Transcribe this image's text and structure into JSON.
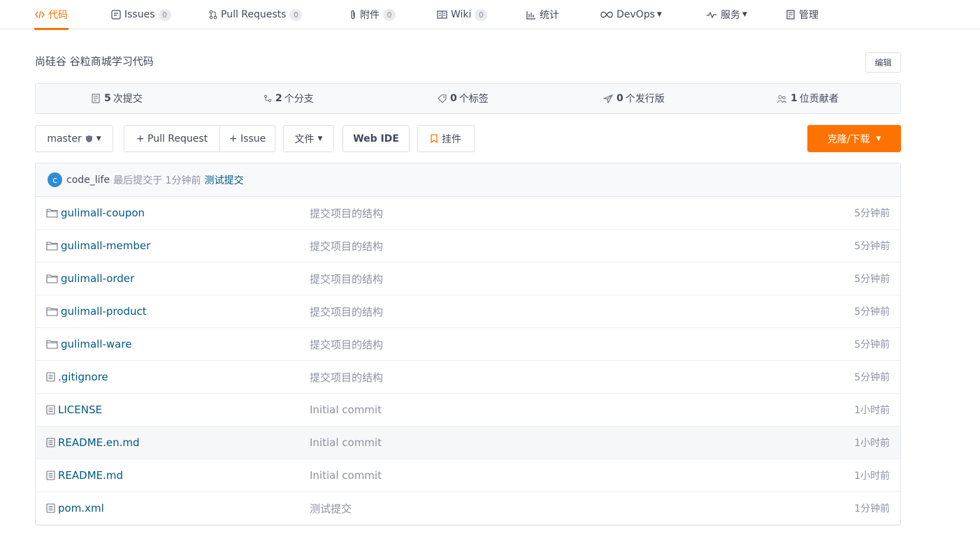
{
  "nav": {
    "tabs": [
      {
        "label": "代码",
        "icon": "code-icon",
        "active": true
      },
      {
        "label": "Issues",
        "badge": "0",
        "icon": "issue-icon"
      },
      {
        "label": "Pull Requests",
        "badge": "0",
        "icon": "pull-request-icon"
      },
      {
        "label": "附件",
        "badge": "0",
        "icon": "paperclip-icon"
      },
      {
        "label": "Wiki",
        "badge": "0",
        "icon": "book-icon"
      },
      {
        "label": "统计",
        "icon": "bar-chart-icon"
      },
      {
        "label": "DevOps",
        "icon": "infinity-icon",
        "dropdown": true
      },
      {
        "label": "服务",
        "icon": "pulse-icon",
        "dropdown": true
      },
      {
        "label": "管理",
        "icon": "manage-icon"
      }
    ]
  },
  "repo": {
    "description": "尚硅谷 谷粒商城学习代码",
    "edit_label": "编辑"
  },
  "stats": [
    {
      "count": "5",
      "label": "次提交",
      "icon": "commit-icon"
    },
    {
      "count": "2",
      "label": "个分支",
      "icon": "branch-icon"
    },
    {
      "count": "0",
      "label": "个标签",
      "icon": "tag-icon"
    },
    {
      "count": "0",
      "label": "个发行版",
      "icon": "release-icon"
    },
    {
      "count": "1",
      "label": "位贡献者",
      "icon": "contributors-icon"
    }
  ],
  "toolbar": {
    "branch": "master",
    "pull_request": "+ Pull Request",
    "issue": "+ Issue",
    "file": "文件",
    "web_ide": "Web IDE",
    "bookmark": "挂件",
    "clone": "克隆/下载"
  },
  "last_commit": {
    "avatar_letter": "c",
    "author": "code_life",
    "meta": "最后提交于 1分钟前",
    "message": "测试提交"
  },
  "files": [
    {
      "name": "gulimall-coupon",
      "type": "folder",
      "message": "提交项目的结构",
      "time": "5分钟前"
    },
    {
      "name": "gulimall-member",
      "type": "folder",
      "message": "提交项目的结构",
      "time": "5分钟前"
    },
    {
      "name": "gulimall-order",
      "type": "folder",
      "message": "提交项目的结构",
      "time": "5分钟前"
    },
    {
      "name": "gulimall-product",
      "type": "folder",
      "message": "提交项目的结构",
      "time": "5分钟前"
    },
    {
      "name": "gulimall-ware",
      "type": "folder",
      "message": "提交项目的结构",
      "time": "5分钟前"
    },
    {
      "name": ".gitignore",
      "type": "file",
      "message": "提交项目的结构",
      "time": "5分钟前"
    },
    {
      "name": "LICENSE",
      "type": "file",
      "message": "Initial commit",
      "time": "1小时前"
    },
    {
      "name": "README.en.md",
      "type": "file",
      "message": "Initial commit",
      "time": "1小时前"
    },
    {
      "name": "README.md",
      "type": "file",
      "message": "Initial commit",
      "time": "1小时前"
    },
    {
      "name": "pom.xml",
      "type": "file",
      "message": "测试提交",
      "time": "1分钟前"
    }
  ],
  "colors": {
    "accent": "#fe7300",
    "link": "#005980",
    "muted": "#8c92a4"
  }
}
